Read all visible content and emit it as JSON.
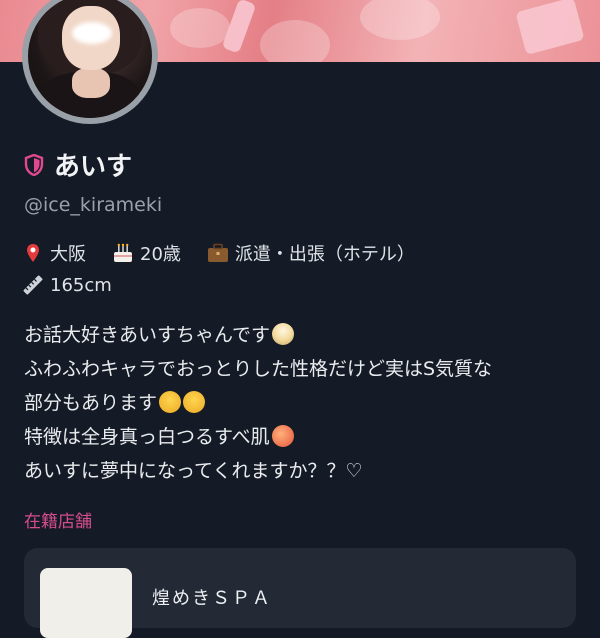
{
  "profile": {
    "name": "あいす",
    "handle": "@ice_kirameki",
    "location": "大阪",
    "age": "20歳",
    "job": "派遣・出張（ホテル）",
    "height": "165cm"
  },
  "bio": {
    "line1": "お話大好きあいすちゃんです",
    "line2": "ふわふわキャラでおっとりした性格だけど実はS気質な",
    "line3": "部分もあります",
    "line4": "特徴は全身真っ白つるすべ肌",
    "line5": "あいすに夢中になってくれますか？？♡"
  },
  "store": {
    "section_label": "在籍店舗",
    "name": "煌めきＳＰＡ"
  },
  "icons": {
    "verified": "shield-icon",
    "location": "pin-icon",
    "age": "cake-icon",
    "job": "briefcase-icon",
    "height": "ruler-icon"
  },
  "colors": {
    "background": "#151b26",
    "accent_pink": "#d64d8c",
    "card": "#232a36"
  }
}
